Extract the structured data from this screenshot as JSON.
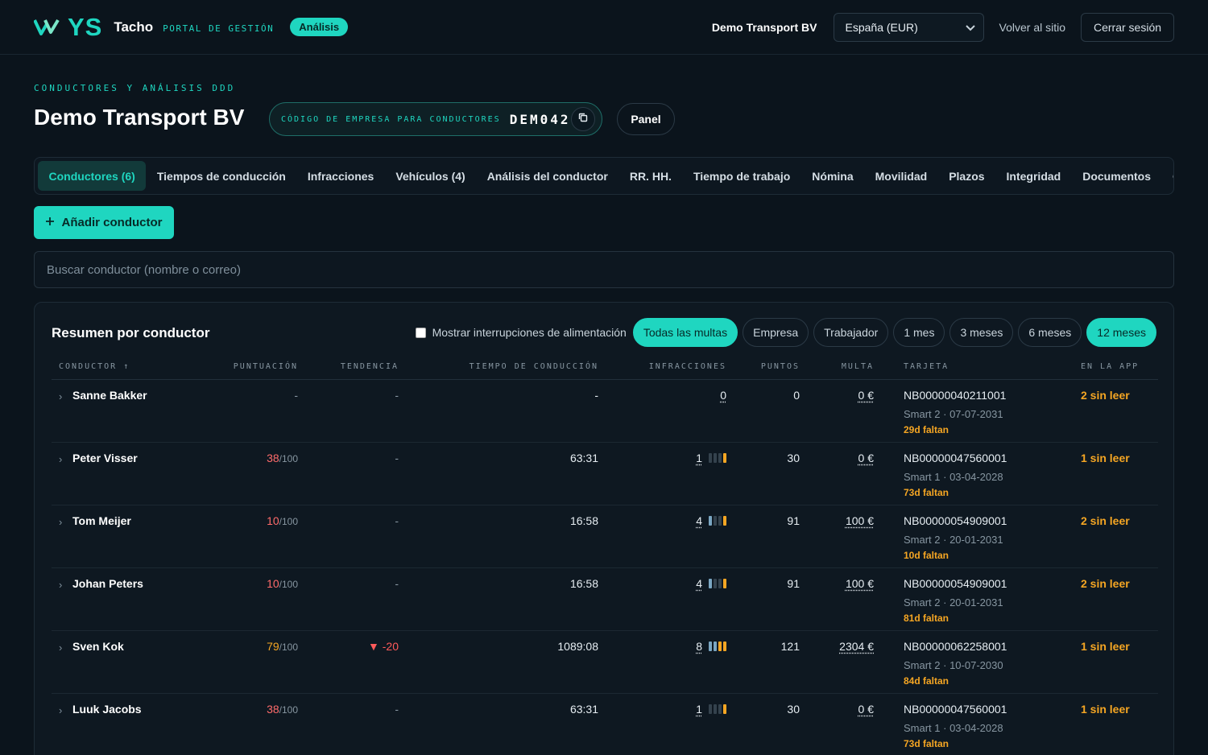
{
  "brand": {
    "logo": "YS",
    "product": "Tacho",
    "subtitle": "PORTAL DE GESTIÓN",
    "badge": "Análisis"
  },
  "topbar": {
    "company": "Demo Transport BV",
    "region": "España (EUR)",
    "back_link": "Volver al sitio",
    "logout": "Cerrar sesión"
  },
  "header": {
    "eyebrow": "CONDUCTORES Y ANÁLISIS DDD",
    "title": "Demo Transport BV",
    "code_label": "CÓDIGO DE EMPRESA PARA CONDUCTORES",
    "code_value": "DEM042",
    "panel_button": "Panel"
  },
  "tabs": [
    {
      "label": "Conductores (6)",
      "active": true
    },
    {
      "label": "Tiempos de conducción"
    },
    {
      "label": "Infracciones"
    },
    {
      "label": "Vehículos (4)"
    },
    {
      "label": "Análisis del conductor"
    },
    {
      "label": "RR. HH."
    },
    {
      "label": "Tiempo de trabajo"
    },
    {
      "label": "Nómina"
    },
    {
      "label": "Movilidad"
    },
    {
      "label": "Plazos"
    },
    {
      "label": "Integridad"
    },
    {
      "label": "Documentos"
    },
    {
      "label": "Org"
    }
  ],
  "actions": {
    "add_driver": "Añadir conductor",
    "search_placeholder": "Buscar conductor (nombre o correo)"
  },
  "summary": {
    "title": "Resumen por conductor",
    "checkbox_label": "Mostrar interrupciones de alimentación",
    "filters": [
      {
        "label": "Todas las multas",
        "active": true
      },
      {
        "label": "Empresa"
      },
      {
        "label": "Trabajador"
      },
      {
        "label": "1 mes"
      },
      {
        "label": "3 meses"
      },
      {
        "label": "6 meses"
      },
      {
        "label": "12 meses",
        "active": true
      }
    ],
    "columns": {
      "driver": "CONDUCTOR ↑",
      "score": "PUNTUACIÓN",
      "trend": "TENDENCIA",
      "drive_time": "TIEMPO DE CONDUCCIÓN",
      "infractions": "INFRACCIONES",
      "points": "PUNTOS",
      "fine": "MULTA",
      "card": "TARJETA",
      "app": "EN LA APP"
    },
    "rows": [
      {
        "name": "Sanne Bakker",
        "score": "-",
        "score_den": "",
        "trend": "-",
        "drive": "-",
        "infr": "0",
        "bars": [],
        "points": "0",
        "fine": "0 €",
        "card": "NB00000040211001",
        "card_sub": "Smart 2 · 07-07-2031",
        "card_left": "29d faltan",
        "app": "2 sin leer"
      },
      {
        "name": "Peter Visser",
        "score": "38",
        "score_den": "/100",
        "trend": "-",
        "drive": "63:31",
        "infr": "1",
        "bars": [
          "g",
          "g",
          "g",
          "o"
        ],
        "points": "30",
        "fine": "0 €",
        "card": "NB00000047560001",
        "card_sub": "Smart 1 · 03-04-2028",
        "card_left": "73d faltan",
        "app": "1 sin leer"
      },
      {
        "name": "Tom Meijer",
        "score": "10",
        "score_den": "/100",
        "trend": "-",
        "drive": "16:58",
        "infr": "4",
        "bars": [
          "b",
          "g",
          "g",
          "o"
        ],
        "points": "91",
        "fine": "100 €",
        "card": "NB00000054909001",
        "card_sub": "Smart 2 · 20-01-2031",
        "card_left": "10d faltan",
        "app": "2 sin leer"
      },
      {
        "name": "Johan Peters",
        "score": "10",
        "score_den": "/100",
        "trend": "-",
        "drive": "16:58",
        "infr": "4",
        "bars": [
          "b",
          "g",
          "g",
          "o"
        ],
        "points": "91",
        "fine": "100 €",
        "card": "NB00000054909001",
        "card_sub": "Smart 2 · 20-01-2031",
        "card_left": "81d faltan",
        "app": "2 sin leer"
      },
      {
        "name": "Sven Kok",
        "score": "79",
        "score_den": "/100",
        "score_warn": true,
        "trend": "▼ -20",
        "trend_down": true,
        "drive": "1089:08",
        "infr": "8",
        "bars": [
          "b",
          "b",
          "o",
          "o"
        ],
        "points": "121",
        "fine": "2304 €",
        "card": "NB00000062258001",
        "card_sub": "Smart 2 · 10-07-2030",
        "card_left": "84d faltan",
        "app": "1 sin leer"
      },
      {
        "name": "Luuk Jacobs",
        "score": "38",
        "score_den": "/100",
        "trend": "-",
        "drive": "63:31",
        "infr": "1",
        "bars": [
          "g",
          "g",
          "g",
          "o"
        ],
        "points": "30",
        "fine": "0 €",
        "card": "NB00000047560001",
        "card_sub": "Smart 1 · 03-04-2028",
        "card_left": "73d faltan",
        "app": "1 sin leer"
      }
    ]
  }
}
